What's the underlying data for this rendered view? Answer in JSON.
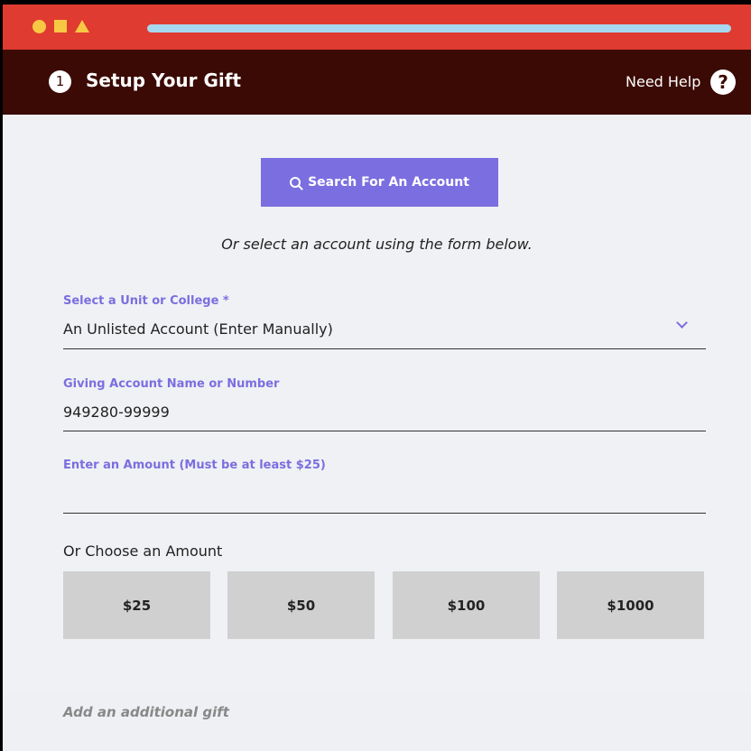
{
  "header": {
    "step_number": "1",
    "title": "Setup Your Gift",
    "help_label": "Need Help",
    "help_icon": "question-circle-icon"
  },
  "search": {
    "button_label": "Search For An Account",
    "icon": "search-icon"
  },
  "or_select_text": "Or select an account using the form below.",
  "unit_field": {
    "label": "Select a Unit or College *",
    "value": "An Unlisted Account (Enter Manually)"
  },
  "account_field": {
    "label": "Giving Account Name or Number",
    "value": "949280-99999"
  },
  "amount_field": {
    "label": "Enter an Amount (Must be at least $25)",
    "value": ""
  },
  "choose_amount": {
    "label": "Or Choose an Amount",
    "options": [
      "$25",
      "$50",
      "$100",
      "$1000"
    ]
  },
  "add_gift_label": "Add an additional gift",
  "colors": {
    "topbar": "#df3b30",
    "header": "#3b0a04",
    "accent": "#7b6ee0",
    "shape_yellow": "#f7c844",
    "urlbar": "#a7d8f0"
  }
}
